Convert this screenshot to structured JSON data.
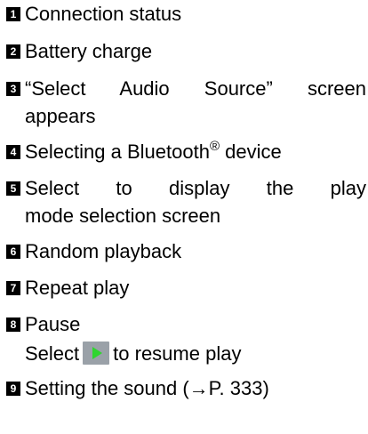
{
  "items": [
    {
      "num": "1",
      "text": "Connection status"
    },
    {
      "num": "2",
      "text": "Battery charge"
    },
    {
      "num": "3",
      "line1": "“Select Audio Source” screen",
      "line2": "appears"
    },
    {
      "num": "4",
      "text_before_sup": "Selecting a Bluetooth",
      "sup": "®",
      "text_after_sup": " device"
    },
    {
      "num": "5",
      "line1": "Select to display the play",
      "line2": "mode selection screen"
    },
    {
      "num": "6",
      "text": "Random playback"
    },
    {
      "num": "7",
      "text": "Repeat play"
    },
    {
      "num": "8",
      "line1": "Pause",
      "line2_before_icon": "Select",
      "icon": "play-icon",
      "line2_after_icon": "to resume play"
    },
    {
      "num": "9",
      "text": "Setting the sound (→P. 333)"
    }
  ]
}
